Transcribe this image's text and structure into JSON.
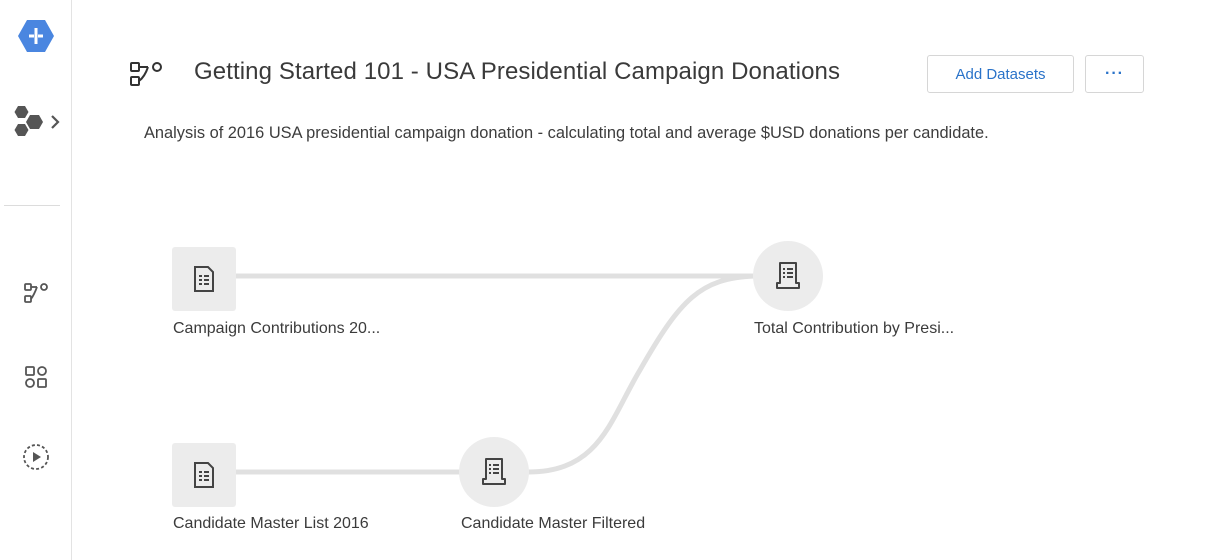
{
  "sidebar": {
    "items": [
      {
        "name": "app-logo",
        "icon": "hexagon-logo-icon"
      },
      {
        "name": "projects-menu",
        "icon": "hexagons-chevron-icon"
      },
      {
        "name": "flows",
        "icon": "flow-icon"
      },
      {
        "name": "library",
        "icon": "grid-icon"
      },
      {
        "name": "jobs",
        "icon": "play-circle-icon"
      }
    ]
  },
  "header": {
    "title": "Getting Started 101 - USA Presidential Campaign Donations",
    "add_datasets_label": "Add Datasets",
    "more_label": "···",
    "description": "Analysis of 2016 USA presidential campaign donation - calculating total and average $USD donations per candidate."
  },
  "flow": {
    "nodes": [
      {
        "id": "campaign",
        "label": "Campaign Contributions 20...",
        "type": "dataset",
        "icon": "dataset-icon"
      },
      {
        "id": "total",
        "label": "Total Contribution by Presi...",
        "type": "recipe",
        "icon": "recipe-icon"
      },
      {
        "id": "candidate-master",
        "label": "Candidate Master List 2016",
        "type": "dataset",
        "icon": "dataset-icon"
      },
      {
        "id": "candidate-filtered",
        "label": "Candidate Master Filtered",
        "type": "recipe",
        "icon": "recipe-icon"
      }
    ],
    "edges": [
      {
        "from": "campaign",
        "to": "total"
      },
      {
        "from": "candidate-master",
        "to": "candidate-filtered"
      },
      {
        "from": "candidate-filtered",
        "to": "total"
      }
    ]
  },
  "colors": {
    "accent": "#2a73c9",
    "logo": "#4a86e0",
    "node_bg": "#ececec",
    "edge": "#e0e0e0",
    "icon": "#444444"
  }
}
